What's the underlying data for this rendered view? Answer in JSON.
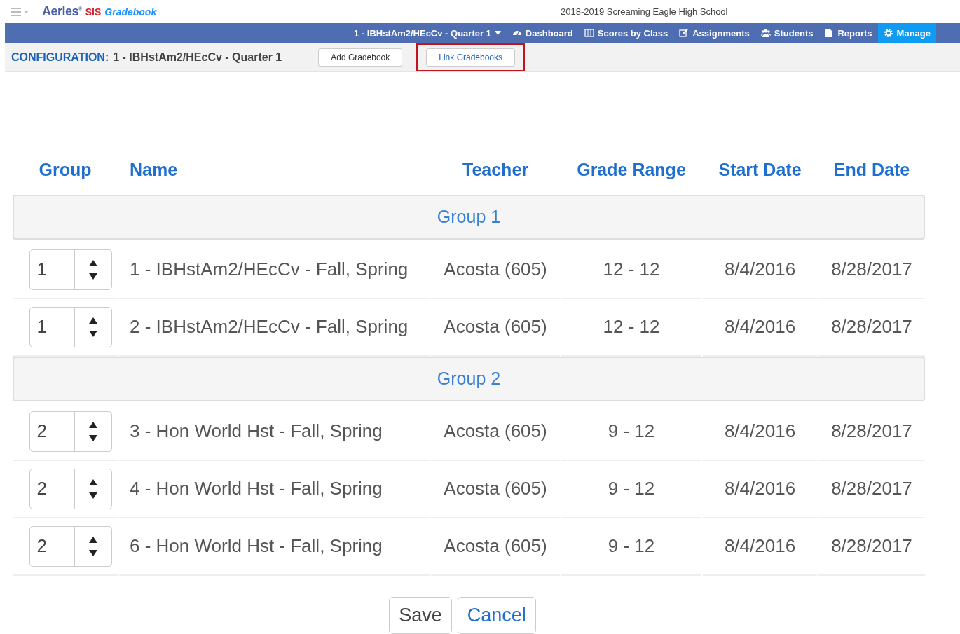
{
  "header": {
    "brand": "Aeries",
    "brand_mark": "®",
    "brand_sis": "SIS",
    "brand_product": "Gradebook",
    "school": "2018-2019 Screaming Eagle High School"
  },
  "nav": {
    "gradebook": "1 - IBHstAm2/HEcCv - Quarter 1",
    "items": [
      {
        "label": "Dashboard",
        "selected": false
      },
      {
        "label": "Scores by Class",
        "selected": false
      },
      {
        "label": "Assignments",
        "selected": false
      },
      {
        "label": "Students",
        "selected": false
      },
      {
        "label": "Reports",
        "selected": false
      },
      {
        "label": "Manage",
        "selected": true
      }
    ]
  },
  "config": {
    "label": "CONFIGURATION:",
    "value": "1 - IBHstAm2/HEcCv - Quarter 1",
    "buttons": [
      {
        "label": "Add Gradebook",
        "highlighted": false
      },
      {
        "label": "Link Gradebooks",
        "highlighted": true
      }
    ]
  },
  "table": {
    "columns": [
      "Group",
      "Name",
      "Teacher",
      "Grade Range",
      "Start Date",
      "End Date"
    ],
    "groups": [
      {
        "label": "Group 1",
        "rows": [
          {
            "group": "1",
            "name": "1 - IBHstAm2/HEcCv - Fall, Spring",
            "teacher": "Acosta (605)",
            "grade_range": "12 - 12",
            "start": "8/4/2016",
            "end": "8/28/2017"
          },
          {
            "group": "1",
            "name": "2 - IBHstAm2/HEcCv - Fall, Spring",
            "teacher": "Acosta (605)",
            "grade_range": "12 - 12",
            "start": "8/4/2016",
            "end": "8/28/2017"
          }
        ]
      },
      {
        "label": "Group 2",
        "rows": [
          {
            "group": "2",
            "name": "3 - Hon World Hst - Fall, Spring",
            "teacher": "Acosta (605)",
            "grade_range": "9 - 12",
            "start": "8/4/2016",
            "end": "8/28/2017"
          },
          {
            "group": "2",
            "name": "4 - Hon World Hst - Fall, Spring",
            "teacher": "Acosta (605)",
            "grade_range": "9 - 12",
            "start": "8/4/2016",
            "end": "8/28/2017"
          },
          {
            "group": "2",
            "name": "6 - Hon World Hst - Fall, Spring",
            "teacher": "Acosta (605)",
            "grade_range": "9 - 12",
            "start": "8/4/2016",
            "end": "8/28/2017"
          }
        ]
      }
    ]
  },
  "actions": [
    "Save",
    "Cancel"
  ]
}
